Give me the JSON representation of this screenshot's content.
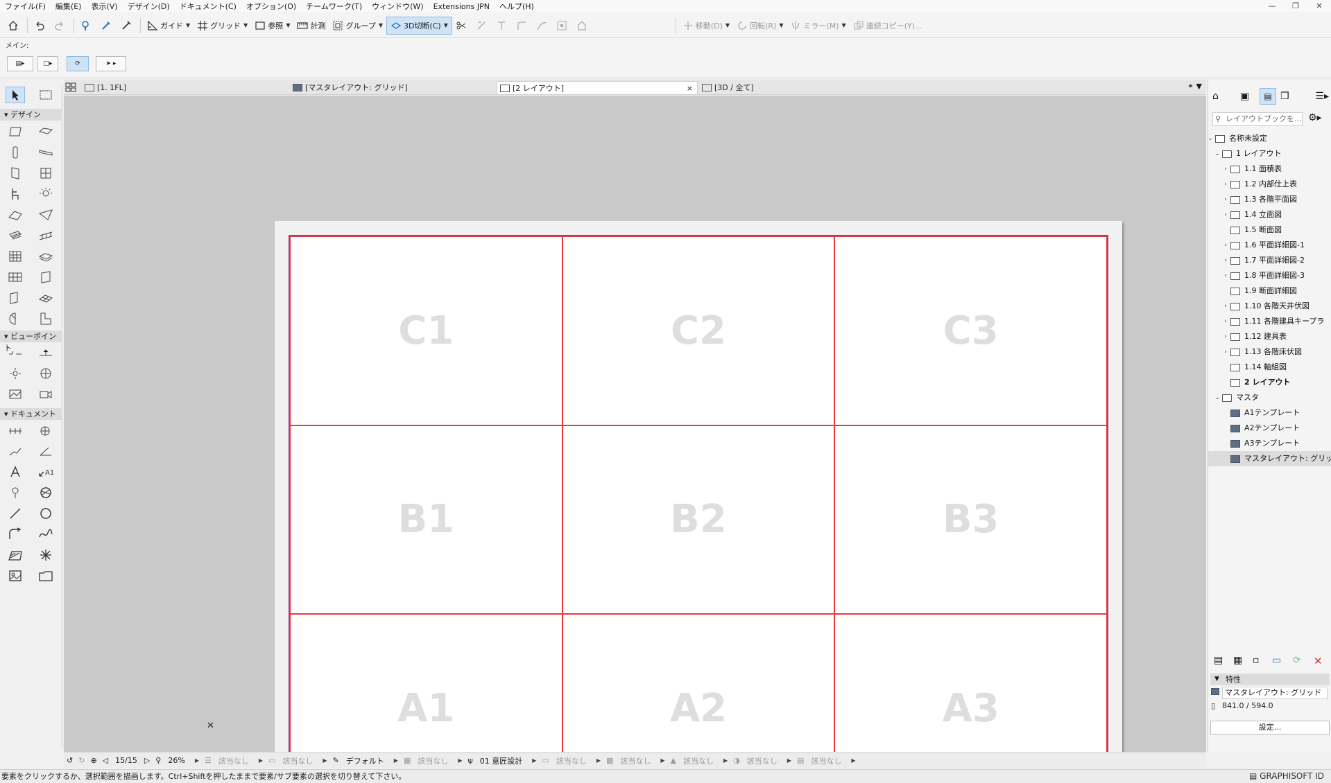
{
  "menu": [
    "ファイル(F)",
    "編集(E)",
    "表示(V)",
    "デザイン(D)",
    "ドキュメント(C)",
    "オプション(O)",
    "チームワーク(T)",
    "ウィンドウ(W)",
    "Extensions JPN",
    "ヘルプ(H)"
  ],
  "toolbar": {
    "guide": "ガイド",
    "grid": "グリッド",
    "reference": "参照",
    "measure": "計測",
    "group": "グループ",
    "cut3d": "3D切断(C)",
    "move": "移動(D)",
    "rotate": "回転(R)",
    "mirror": "ミラー(M)",
    "multiply": "連続コピー(Y)..."
  },
  "infobox": {
    "label": "メイン:"
  },
  "toolbox": {
    "design": "デザイン",
    "viewpoint": "ビューポイント",
    "document": "ドキュメント"
  },
  "tabs": [
    {
      "label": "[1. 1FL]"
    },
    {
      "label": "[マスタレイアウト: グリッド]"
    },
    {
      "label": "[2 レイアウト]",
      "close": "×"
    },
    {
      "label": "[3D / 全て]"
    }
  ],
  "grid_cells": [
    "C1",
    "C2",
    "C3",
    "B1",
    "B2",
    "B3",
    "A1",
    "A2",
    "A3"
  ],
  "navigator": {
    "search_placeholder": "レイアウトブックを...",
    "tree": [
      {
        "label": "名称未設定",
        "arrow": "v",
        "kind": "book"
      },
      {
        "label": "1 レイアウト",
        "arrow": "v",
        "kind": "folder"
      },
      {
        "label": "1.1 面積表",
        "arrow": ">",
        "kind": "layout"
      },
      {
        "label": "1.2 内部仕上表",
        "arrow": ">",
        "kind": "layout"
      },
      {
        "label": "1.3 各階平面図",
        "arrow": ">",
        "kind": "layout"
      },
      {
        "label": "1.4 立面図",
        "arrow": ">",
        "kind": "layout"
      },
      {
        "label": "1.5 断面図",
        "arrow": "",
        "kind": "layout"
      },
      {
        "label": "1.6 平面詳細図-1",
        "arrow": ">",
        "kind": "layout"
      },
      {
        "label": "1.7 平面詳細図-2",
        "arrow": ">",
        "kind": "layout"
      },
      {
        "label": "1.8 平面詳細図-3",
        "arrow": ">",
        "kind": "layout"
      },
      {
        "label": "1.9 断面詳細図",
        "arrow": "",
        "kind": "layout"
      },
      {
        "label": "1.10 各階天井伏図",
        "arrow": ">",
        "kind": "layout"
      },
      {
        "label": "1.11 各階建具キープラ",
        "arrow": ">",
        "kind": "layout"
      },
      {
        "label": "1.12 建具表",
        "arrow": ">",
        "kind": "layout"
      },
      {
        "label": "1.13 各階床伏図",
        "arrow": ">",
        "kind": "layout"
      },
      {
        "label": "1.14 軸組図",
        "arrow": "",
        "kind": "layout"
      },
      {
        "label": "2 レイアウト",
        "arrow": "",
        "kind": "layout",
        "bold": true
      },
      {
        "label": "マスタ",
        "arrow": "v",
        "kind": "folder"
      },
      {
        "label": "A1テンプレート",
        "arrow": "",
        "kind": "master"
      },
      {
        "label": "A2テンプレート",
        "arrow": "",
        "kind": "master"
      },
      {
        "label": "A3テンプレート",
        "arrow": "",
        "kind": "master"
      },
      {
        "label": "マスタレイアウト: グリッド",
        "arrow": "",
        "kind": "master",
        "selected": true
      }
    ]
  },
  "properties": {
    "header": "特性",
    "name": "マスタレイアウト: グリッド",
    "size": "841.0 / 594.0",
    "settings": "設定..."
  },
  "quickbar": {
    "page": "15/15",
    "zoom": "26%",
    "none": "該当なし",
    "default": "デフォルト",
    "design": "01 意匠設計"
  },
  "status": "要素をクリックするか、選択範囲を描画します。Ctrl+Shiftを押したままで要素/サブ要素の選択を切り替えて下さい。",
  "brand": "GRAPHISOFT ID",
  "colors": {
    "grid_line": "#e83a3a",
    "border": "#a6389c",
    "active_tool": "#cfe3f7"
  }
}
